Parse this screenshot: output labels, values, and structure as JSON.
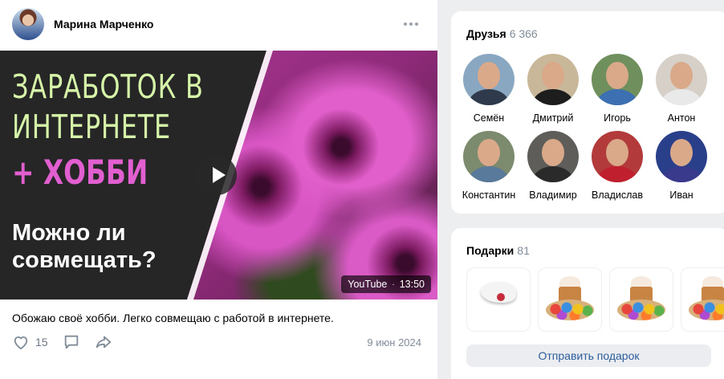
{
  "post": {
    "author": "Марина Марченко",
    "video": {
      "title_line1": "ЗАРАБОТОК В",
      "title_line2": "ИНТЕРНЕТЕ",
      "title_accent": "+ ХОББИ",
      "subtitle_line1": "Можно ли",
      "subtitle_line2": "совмещать?",
      "source": "YouTube",
      "separator": "·",
      "duration": "13:50"
    },
    "text": "Обожаю своё хобби. Легко совмещаю с работой в интернете.",
    "likes": "15",
    "date": "9 июн 2024"
  },
  "friends": {
    "title": "Друзья",
    "count": "6 366",
    "items": [
      {
        "name": "Семён",
        "shirt": "#2f3b4c"
      },
      {
        "name": "Дмитрий",
        "shirt": "#1d1d1d"
      },
      {
        "name": "Игорь",
        "shirt": "#3d6fb3"
      },
      {
        "name": "Антон",
        "shirt": "#e9e9e9"
      },
      {
        "name": "Константин",
        "shirt": "#5a7a9c"
      },
      {
        "name": "Владимир",
        "shirt": "#2a2a2a"
      },
      {
        "name": "Владислав",
        "shirt": "#c0202d"
      },
      {
        "name": "Иван",
        "shirt": "#3a3a8c"
      }
    ]
  },
  "gifts": {
    "title": "Подарки",
    "count": "81",
    "items": [
      "dove-icon",
      "easter-cake-icon",
      "easter-cake-icon",
      "easter-cake-icon"
    ],
    "button_label": "Отправить подарок"
  },
  "colors": {
    "accent_pink": "#e15fd0",
    "accent_green": "#d6f5a8",
    "link_blue": "#2c5d9a"
  }
}
